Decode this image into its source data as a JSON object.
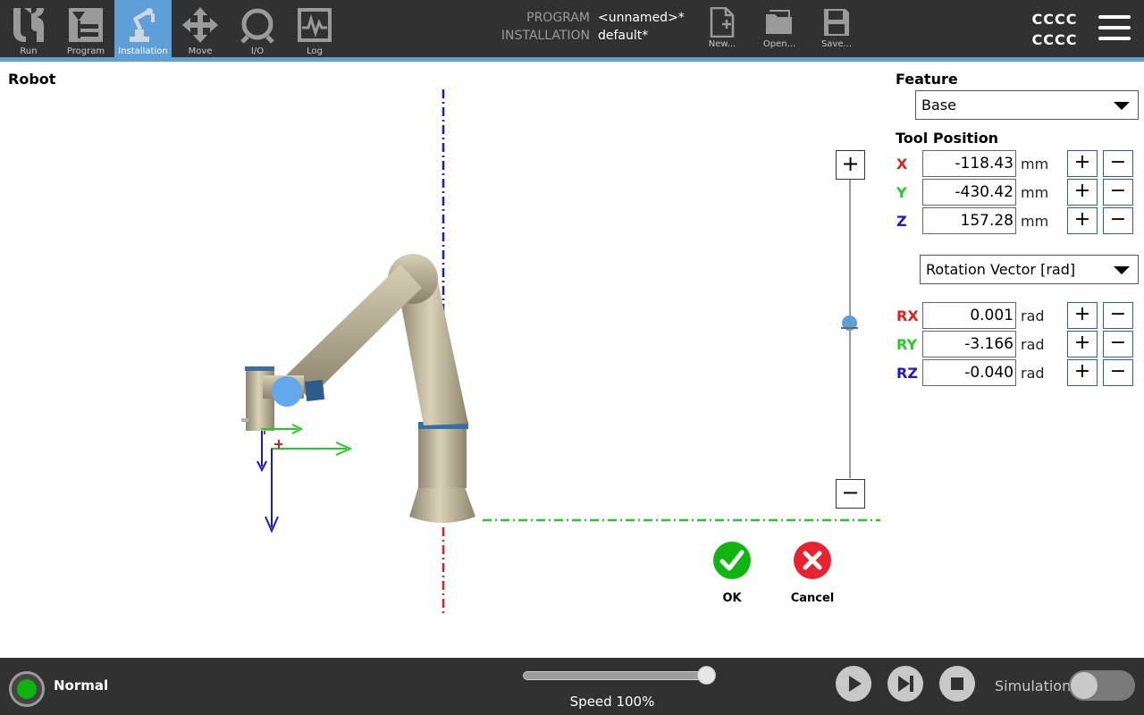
{
  "header": {
    "tabs": [
      {
        "label": "Run",
        "icon": "ur-logo-icon"
      },
      {
        "label": "Program",
        "icon": "program-tree-icon"
      },
      {
        "label": "Installation",
        "icon": "robot-arm-icon",
        "active": true
      },
      {
        "label": "Move",
        "icon": "move-arrows-icon"
      },
      {
        "label": "I/O",
        "icon": "io-icon"
      },
      {
        "label": "Log",
        "icon": "log-chart-icon"
      }
    ],
    "program_label": "PROGRAM",
    "program_value": "<unnamed>*",
    "installation_label": "INSTALLATION",
    "installation_value": "default*",
    "file_buttons": [
      {
        "label": "New...",
        "icon": "new-file-icon"
      },
      {
        "label": "Open...",
        "icon": "open-folder-icon"
      },
      {
        "label": "Save...",
        "icon": "save-disk-icon"
      }
    ],
    "id_line1": "CCCC",
    "id_line2": "CCCC",
    "accent_color": "#5d9fd6"
  },
  "main": {
    "robot_title": "Robot",
    "zoom_in": "+",
    "zoom_out": "−",
    "zoom_level": 0.5,
    "ok_label": "OK",
    "cancel_label": "Cancel",
    "ok_color": "#11b50f",
    "cancel_color": "#e8232f"
  },
  "panel": {
    "feature_title": "Feature",
    "feature_value": "Base",
    "tool_position_title": "Tool Position",
    "position": [
      {
        "axis": "X",
        "value": "-118.43",
        "unit": "mm",
        "color": "#e02020"
      },
      {
        "axis": "Y",
        "value": "-430.42",
        "unit": "mm",
        "color": "#22cc22"
      },
      {
        "axis": "Z",
        "value": "157.28",
        "unit": "mm",
        "color": "#1a1acc"
      }
    ],
    "rotation_mode": "Rotation Vector [rad]",
    "rotation": [
      {
        "axis": "RX",
        "value": "0.001",
        "unit": "rad",
        "color": "#e02020"
      },
      {
        "axis": "RY",
        "value": "-3.166",
        "unit": "rad",
        "color": "#22cc22"
      },
      {
        "axis": "RZ",
        "value": "-0.040",
        "unit": "rad",
        "color": "#1a1acc"
      }
    ],
    "plus": "+",
    "minus": "−"
  },
  "footer": {
    "status": "Normal",
    "status_color": "#0fb30f",
    "speed_text": "Speed 100%",
    "speed_fraction": 1.0,
    "simulation_label": "Simulation",
    "simulation_on": false
  }
}
